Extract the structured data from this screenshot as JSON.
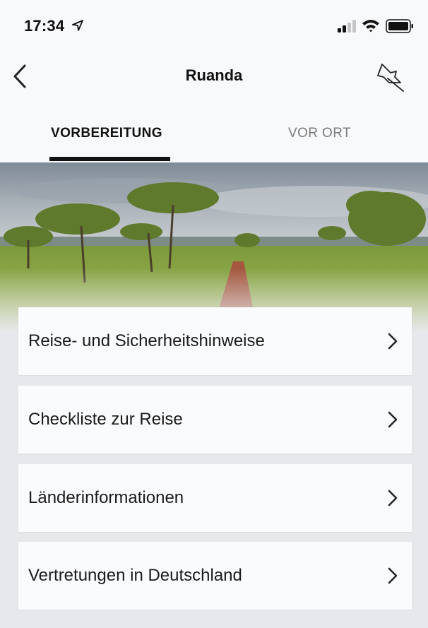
{
  "status": {
    "time": "17:34"
  },
  "header": {
    "title": "Ruanda"
  },
  "tabs": [
    {
      "label": "VORBEREITUNG",
      "active": true
    },
    {
      "label": "VOR ORT",
      "active": false
    }
  ],
  "menu": [
    {
      "label": "Reise- und Sicherheitshinweise"
    },
    {
      "label": "Checkliste zur Reise"
    },
    {
      "label": "Länderinformationen"
    },
    {
      "label": "Vertretungen in Deutschland"
    }
  ],
  "icons": {
    "location": "location-arrow-icon",
    "signal": "cellular-signal-icon",
    "wifi": "wifi-icon",
    "battery": "battery-icon",
    "back": "chevron-left-icon",
    "pin": "pushpin-icon",
    "chevron": "chevron-right-icon"
  },
  "colors": {
    "background": "#e6e8ec",
    "bar": "#f8f9fb",
    "card": "#fafbfd",
    "tab_inactive": "#7a7a7a"
  }
}
